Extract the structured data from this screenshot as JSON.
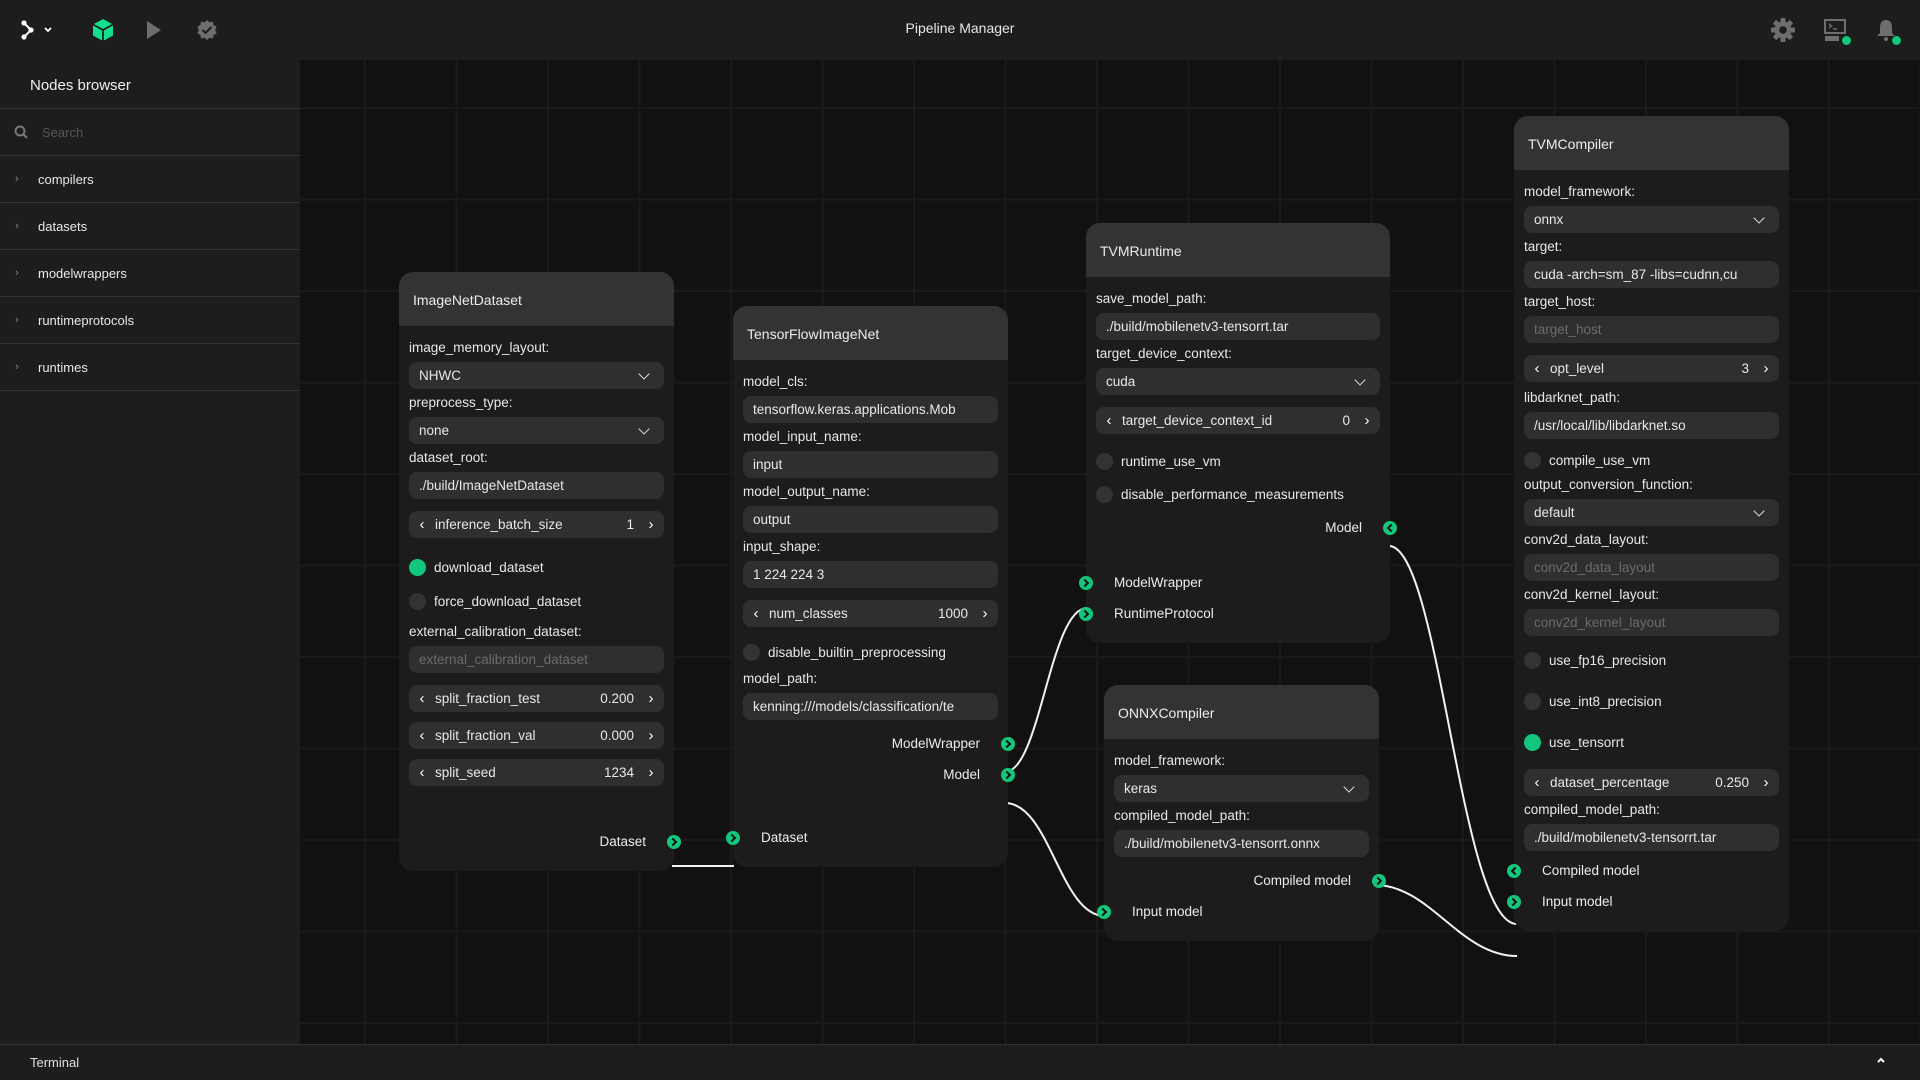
{
  "app": {
    "title": "Pipeline Manager",
    "accent": "#12c77d"
  },
  "topbar": {
    "left_icons": [
      "graph-menu-icon",
      "chevron-down-icon",
      "cube-logo-icon",
      "run-icon",
      "validate-icon"
    ],
    "right_icons": [
      "settings-icon",
      "terminal-icon",
      "notification-bell-icon"
    ]
  },
  "sidebar": {
    "title": "Nodes browser",
    "search_placeholder": "Search",
    "items": [
      {
        "label": "compilers"
      },
      {
        "label": "datasets"
      },
      {
        "label": "modelwrappers"
      },
      {
        "label": "runtimeprotocols"
      },
      {
        "label": "runtimes"
      }
    ]
  },
  "bottombar": {
    "label": "Terminal"
  },
  "nodes": {
    "imagenet": {
      "title": "ImageNetDataset",
      "image_memory_layout_label": "image_memory_layout:",
      "image_memory_layout": "NHWC",
      "preprocess_type_label": "preprocess_type:",
      "preprocess_type": "none",
      "dataset_root_label": "dataset_root:",
      "dataset_root": "./build/ImageNetDataset",
      "inference_batch_size_label": "inference_batch_size",
      "inference_batch_size": "1",
      "download_dataset_label": "download_dataset",
      "download_dataset": true,
      "force_download_dataset_label": "force_download_dataset",
      "force_download_dataset": false,
      "external_calibration_dataset_label": "external_calibration_dataset:",
      "external_calibration_dataset_placeholder": "external_calibration_dataset",
      "split_fraction_test_label": "split_fraction_test",
      "split_fraction_test": "0.200",
      "split_fraction_val_label": "split_fraction_val",
      "split_fraction_val": "0.000",
      "split_seed_label": "split_seed",
      "split_seed": "1234",
      "out_dataset": "Dataset"
    },
    "tfimagenet": {
      "title": "TensorFlowImageNet",
      "model_cls_label": "model_cls:",
      "model_cls": "tensorflow.keras.applications.Mob",
      "model_input_name_label": "model_input_name:",
      "model_input_name": "input",
      "model_output_name_label": "model_output_name:",
      "model_output_name": "output",
      "input_shape_label": "input_shape:",
      "input_shape": "1 224 224 3",
      "num_classes_label": "num_classes",
      "num_classes": "1000",
      "disable_builtin_preprocessing_label": "disable_builtin_preprocessing",
      "disable_builtin_preprocessing": false,
      "model_path_label": "model_path:",
      "model_path": "kenning:///models/classification/te",
      "out_modelwrapper": "ModelWrapper",
      "out_model": "Model",
      "in_dataset": "Dataset"
    },
    "tvmruntime": {
      "title": "TVMRuntime",
      "save_model_path_label": "save_model_path:",
      "save_model_path": "./build/mobilenetv3-tensorrt.tar",
      "target_device_context_label": "target_device_context:",
      "target_device_context": "cuda",
      "target_device_context_id_label": "target_device_context_id",
      "target_device_context_id": "0",
      "runtime_use_vm_label": "runtime_use_vm",
      "runtime_use_vm": false,
      "disable_performance_measurements_label": "disable_performance_measurements",
      "disable_performance_measurements": false,
      "out_model": "Model",
      "in_modelwrapper": "ModelWrapper",
      "in_runtimeprotocol": "RuntimeProtocol"
    },
    "onnxcompiler": {
      "title": "ONNXCompiler",
      "model_framework_label": "model_framework:",
      "model_framework": "keras",
      "compiled_model_path_label": "compiled_model_path:",
      "compiled_model_path": "./build/mobilenetv3-tensorrt.onnx",
      "out_compiled_model": "Compiled model",
      "in_input_model": "Input model"
    },
    "tvmcompiler": {
      "title": "TVMCompiler",
      "model_framework_label": "model_framework:",
      "model_framework": "onnx",
      "target_label": "target:",
      "target": "cuda -arch=sm_87 -libs=cudnn,cu",
      "target_host_label": "target_host:",
      "target_host_placeholder": "target_host",
      "opt_level_label": "opt_level",
      "opt_level": "3",
      "libdarknet_path_label": "libdarknet_path:",
      "libdarknet_path": "/usr/local/lib/libdarknet.so",
      "compile_use_vm_label": "compile_use_vm",
      "compile_use_vm": false,
      "output_conversion_function_label": "output_conversion_function:",
      "output_conversion_function": "default",
      "conv2d_data_layout_label": "conv2d_data_layout:",
      "conv2d_data_layout_placeholder": "conv2d_data_layout",
      "conv2d_kernel_layout_label": "conv2d_kernel_layout:",
      "conv2d_kernel_layout_placeholder": "conv2d_kernel_layout",
      "use_fp16_precision_label": "use_fp16_precision",
      "use_fp16_precision": false,
      "use_int8_precision_label": "use_int8_precision",
      "use_int8_precision": false,
      "use_tensorrt_label": "use_tensorrt",
      "use_tensorrt": true,
      "dataset_percentage_label": "dataset_percentage",
      "dataset_percentage": "0.250",
      "compiled_model_path_label": "compiled_model_path:",
      "compiled_model_path": "./build/mobilenetv3-tensorrt.tar",
      "in_compiled_model": "Compiled model",
      "in_input_model": "Input model"
    }
  },
  "connections": [
    {
      "from": "ImageNetDataset.Dataset",
      "to": "TensorFlowImageNet.Dataset"
    },
    {
      "from": "TensorFlowImageNet.ModelWrapper",
      "to": "TVMRuntime.ModelWrapper"
    },
    {
      "from": "TensorFlowImageNet.Model",
      "to": "ONNXCompiler.Input model"
    },
    {
      "from": "ONNXCompiler.Compiled model",
      "to": "TVMCompiler.Input model"
    },
    {
      "from": "TVMRuntime.Model",
      "to": "TVMCompiler.Compiled model"
    }
  ]
}
